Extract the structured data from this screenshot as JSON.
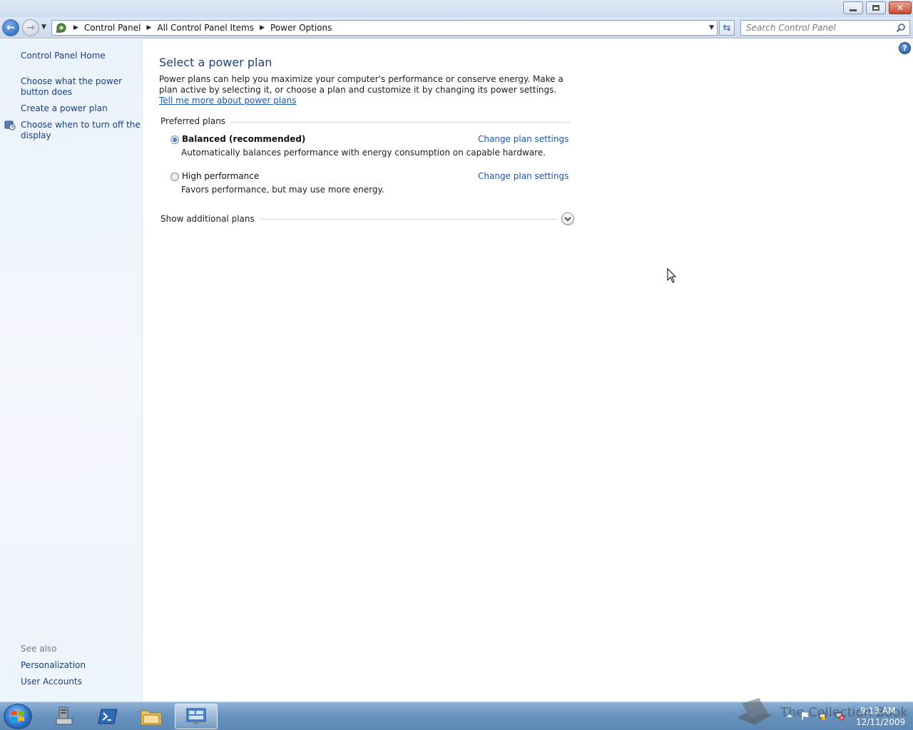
{
  "window": {
    "minimize_glyph": "",
    "close_glyph": "✕"
  },
  "navbar": {
    "breadcrumbs": [
      "Control Panel",
      "All Control Panel Items",
      "Power Options"
    ],
    "search_placeholder": "Search Control Panel"
  },
  "sidebar": {
    "home": "Control Panel Home",
    "links": [
      "Choose what the power button does",
      "Create a power plan",
      "Choose when to turn off the display"
    ],
    "see_also_label": "See also",
    "see_also": [
      "Personalization",
      "User Accounts"
    ]
  },
  "main": {
    "title": "Select a power plan",
    "intro_text": "Power plans can help you maximize your computer's performance or conserve energy. Make a plan active by selecting it, or choose a plan and customize it by changing its power settings. ",
    "intro_link": "Tell me more about power plans",
    "preferred_label": "Preferred plans",
    "plans": [
      {
        "name": "Balanced (recommended)",
        "description": "Automatically balances performance with energy consumption on capable hardware.",
        "change_link": "Change plan settings",
        "selected": true
      },
      {
        "name": "High performance",
        "description": "Favors performance, but may use more energy.",
        "change_link": "Change plan settings",
        "selected": false
      }
    ],
    "show_more": "Show additional plans"
  },
  "taskbar": {
    "time": "9:13 AM",
    "date": "12/11/2009",
    "watermark": "The Collection Book"
  }
}
